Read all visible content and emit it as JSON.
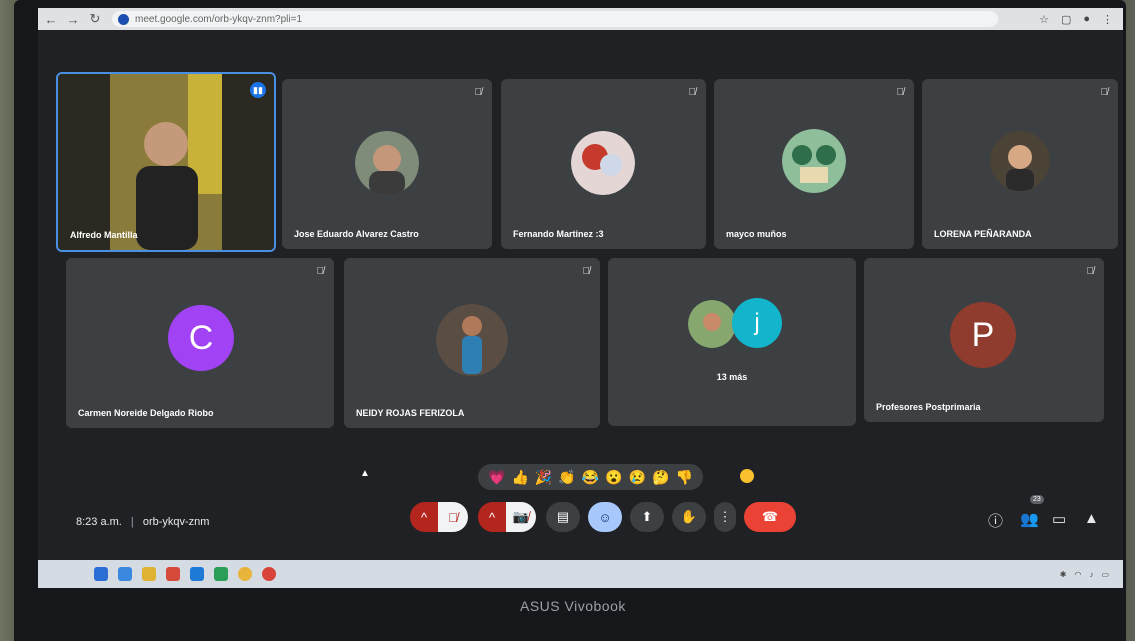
{
  "browser": {
    "url": "meet.google.com/orb-ykqv-znm?pli=1",
    "back_icon": "back-arrow-icon",
    "forward_icon": "forward-arrow-icon",
    "reload_icon": "reload-icon"
  },
  "tiles": [
    {
      "name": "Alfredo Mantilla",
      "type": "video",
      "speaking": true
    },
    {
      "name": "Jose Eduardo Alvarez Castro",
      "type": "photo",
      "muted": true
    },
    {
      "name": "Fernando Martinez :3",
      "type": "photo",
      "muted": true
    },
    {
      "name": "mayco muños",
      "type": "photo",
      "muted": true
    },
    {
      "name": "LORENA PEÑARANDA",
      "type": "photo",
      "muted": true
    },
    {
      "name": "Carmen Noreide Delgado Riobo",
      "type": "letter",
      "letter": "C",
      "color": "#a142f4",
      "muted": true
    },
    {
      "name": "NEIDY ROJAS FERIZOLA",
      "type": "photo",
      "muted": true
    },
    {
      "name": "13 más",
      "type": "group",
      "letter": "j",
      "color": "#12b5cb"
    },
    {
      "name": "Profesores Postprimaria",
      "type": "letter",
      "letter": "P",
      "color": "#8f3b2d",
      "muted": true
    }
  ],
  "reactions": [
    "💗",
    "👍",
    "🎉",
    "👏",
    "😂",
    "😮",
    "😢",
    "🤔",
    "👎"
  ],
  "footer": {
    "time": "8:23 a.m.",
    "separator": "|",
    "meeting_code": "orb-ykqv-znm"
  },
  "controls": {
    "mic_chevron": "^",
    "cam_chevron": "^",
    "more": "⋮",
    "participants_count": "23"
  },
  "device": {
    "brand": "ASUS Vivobook"
  },
  "colors": {
    "accent_blue": "#1a73e8",
    "hangup_red": "#ea4335",
    "muted_red": "#b3261e"
  }
}
